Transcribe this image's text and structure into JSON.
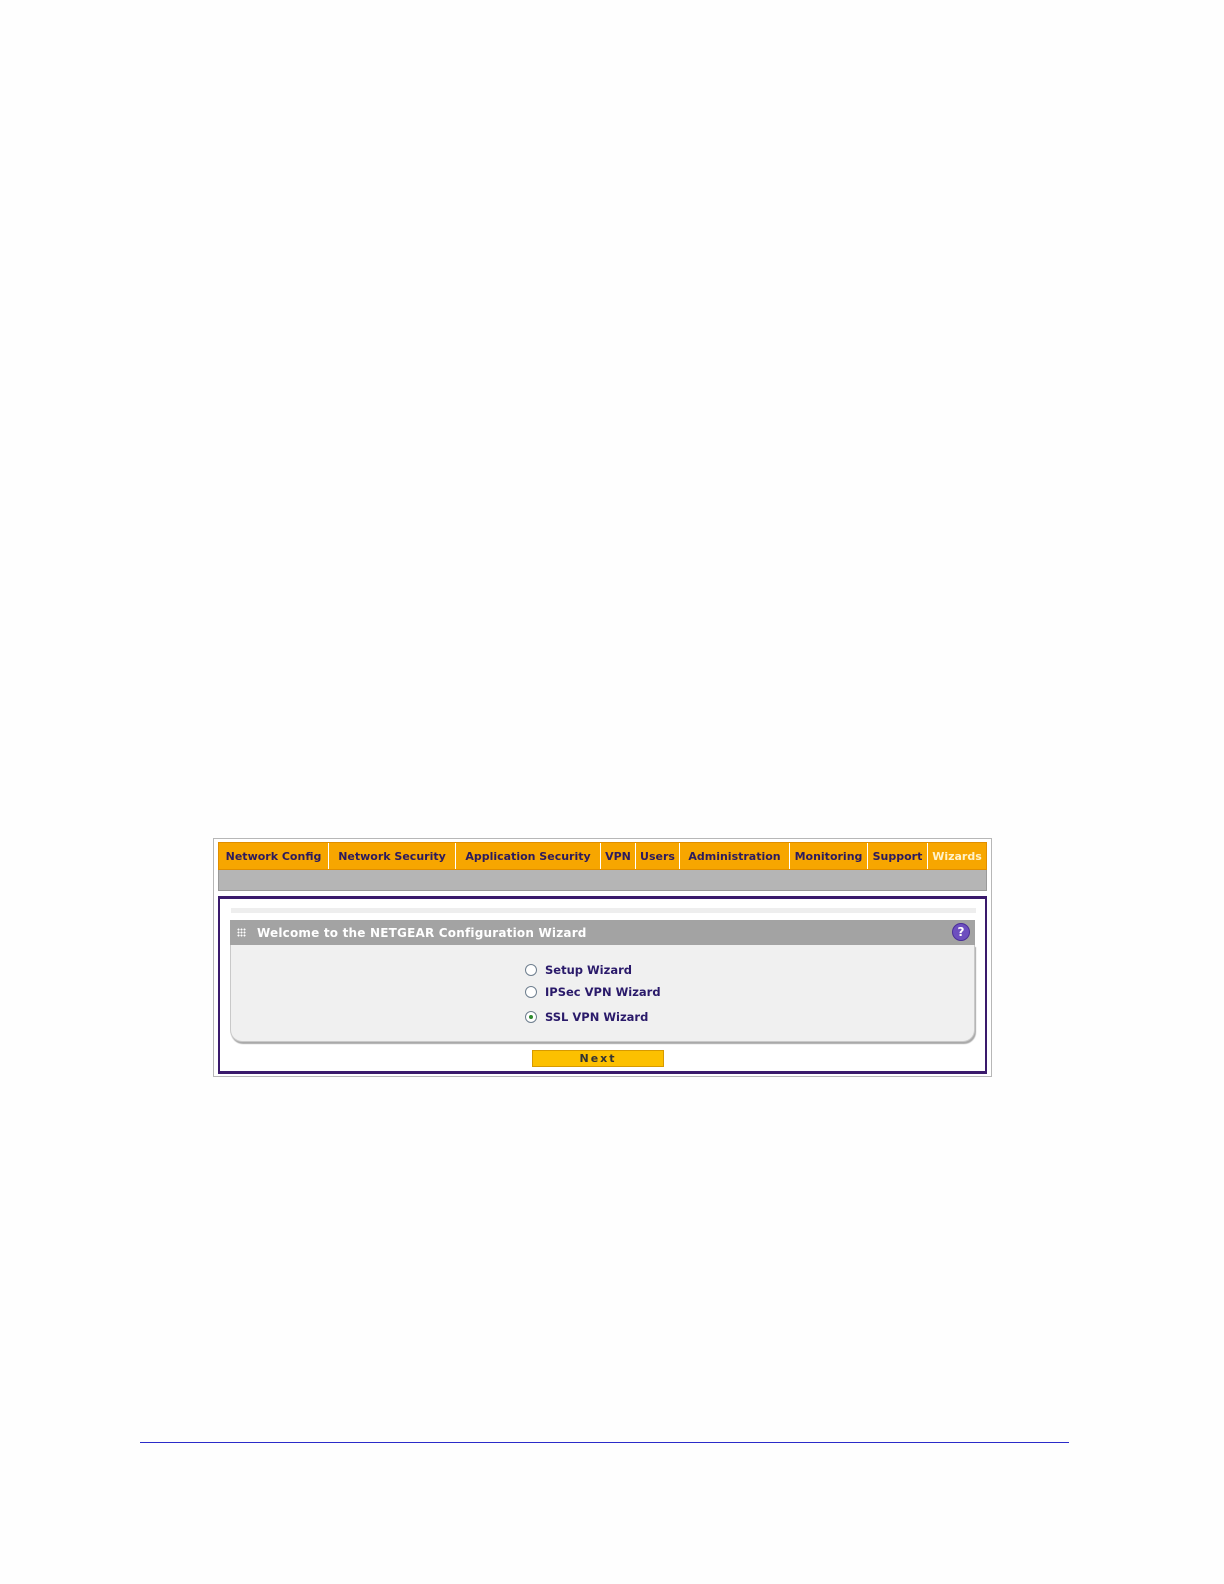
{
  "nav": {
    "tabs": [
      {
        "label": "Network Config"
      },
      {
        "label": "Network Security"
      },
      {
        "label": "Application Security"
      },
      {
        "label": "VPN"
      },
      {
        "label": "Users"
      },
      {
        "label": "Administration"
      },
      {
        "label": "Monitoring"
      },
      {
        "label": "Support"
      },
      {
        "label": "Wizards",
        "active": true
      }
    ]
  },
  "panel": {
    "title": "Welcome to the NETGEAR Configuration Wizard",
    "help_glyph": "?",
    "options": [
      {
        "label": "Setup Wizard",
        "checked": false
      },
      {
        "label": "IPSec VPN Wizard",
        "checked": false
      },
      {
        "label": "SSL VPN Wizard",
        "checked": true
      }
    ]
  },
  "actions": {
    "next_label": "Next"
  },
  "colors": {
    "nav_bg": "#f7a600",
    "nav_text": "#2b1a5e",
    "active_tab_text": "#fff2c9",
    "frame_border": "#3a1a6c",
    "header_bg": "#a3a3a3",
    "button_bg": "#fcc000",
    "footer_rule": "#2b2bc9"
  }
}
